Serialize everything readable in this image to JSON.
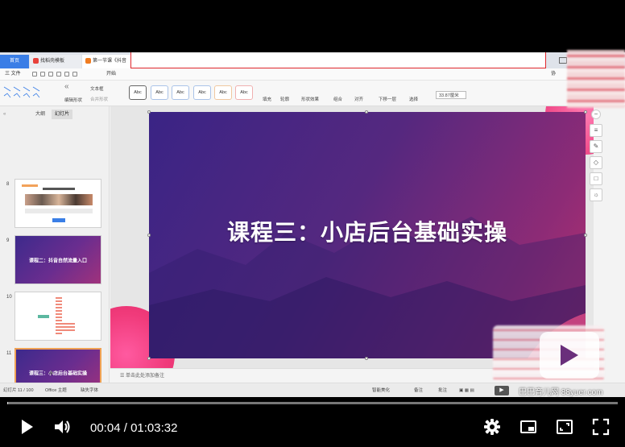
{
  "wps": {
    "tabs": {
      "home": "首页",
      "templates": "找稻壳模板",
      "document": "第一节课《抖音"
    },
    "menu": {
      "file": "三 文件",
      "start": "开始",
      "right_label": "协"
    },
    "ribbon": {
      "edit_shape": "编辑形状",
      "text_box": "文本框",
      "merge_shape": "合并形状",
      "fill": "填充",
      "outline": "轮廓",
      "shape_effect": "形状效果",
      "combine": "组合",
      "align": "对齐",
      "move_down": "下移一层",
      "select": "选择",
      "width_value": "33.87厘米",
      "style_sample": "Abc"
    },
    "left_panel": {
      "outline_tab": "大纲",
      "slides_tab": "幻灯片",
      "slides": [
        {
          "number": "8",
          "title": ""
        },
        {
          "number": "9",
          "title": "课程二：抖音自然流量入口"
        },
        {
          "number": "10",
          "title": ""
        },
        {
          "number": "11",
          "title": "课程三：小店后台基础实操"
        },
        {
          "number": "12",
          "title": ""
        }
      ],
      "add": "+"
    },
    "slide": {
      "title": "课程三：小店后台基础实操"
    },
    "notes_placeholder": "单击此处添加备注",
    "status": {
      "slide_count": "幻灯片 11 / 100",
      "theme": "Office 主题",
      "missing_font": "缺失字体",
      "smart_beautify": "智能美化",
      "notes": "备注",
      "comment": "批注"
    }
  },
  "watermark": "巴巴育儿网 88yuer.com",
  "player": {
    "current_time": "00:04",
    "separator": " / ",
    "duration": "01:03:32",
    "progress_fraction": 0.0011
  },
  "colors": {
    "slide_start": "#3a2485",
    "slide_end": "#b83270",
    "accent_blue": "#3a7ee6",
    "highlight_red": "#e0262c"
  }
}
